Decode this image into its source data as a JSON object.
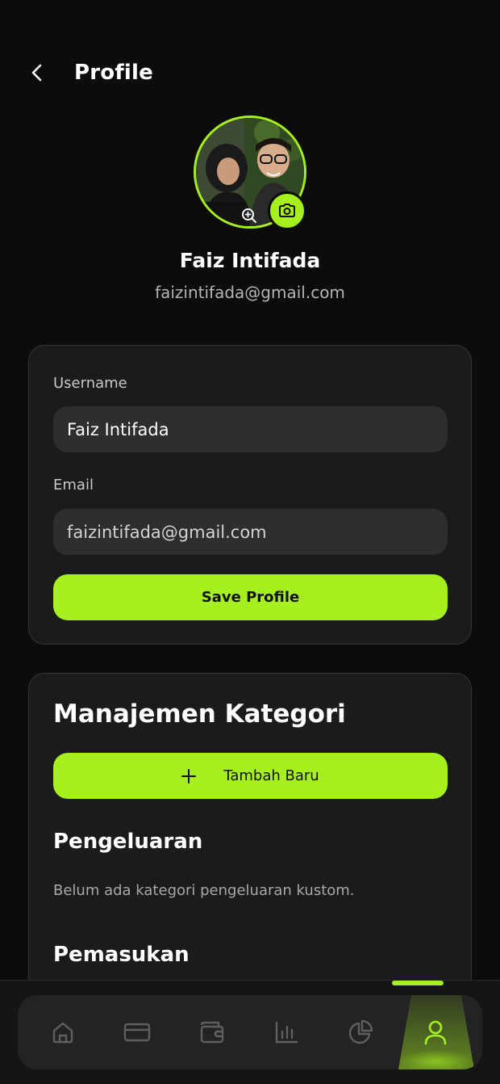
{
  "header": {
    "title": "Profile"
  },
  "profile": {
    "name": "Faiz Intifada",
    "email": "faizintifada@gmail.com"
  },
  "form": {
    "username_label": "Username",
    "username_value": "Faiz Intifada",
    "email_label": "Email",
    "email_value": "faizintifada@gmail.com",
    "save_label": "Save Profile"
  },
  "category": {
    "title": "Manajemen Kategori",
    "add_label": "Tambah Baru",
    "expense_title": "Pengeluaran",
    "expense_empty": "Belum ada kategori pengeluaran kustom.",
    "income_title": "Pemasukan"
  },
  "nav": {
    "items": [
      "home-icon",
      "card-icon",
      "wallet-icon",
      "chart-icon",
      "pie-chart-icon",
      "user-icon"
    ],
    "active": "user-icon"
  },
  "colors": {
    "accent": "#a6f01f",
    "background": "#0c0c0c",
    "card": "#1b1b1b",
    "input": "#2e2e2e"
  }
}
